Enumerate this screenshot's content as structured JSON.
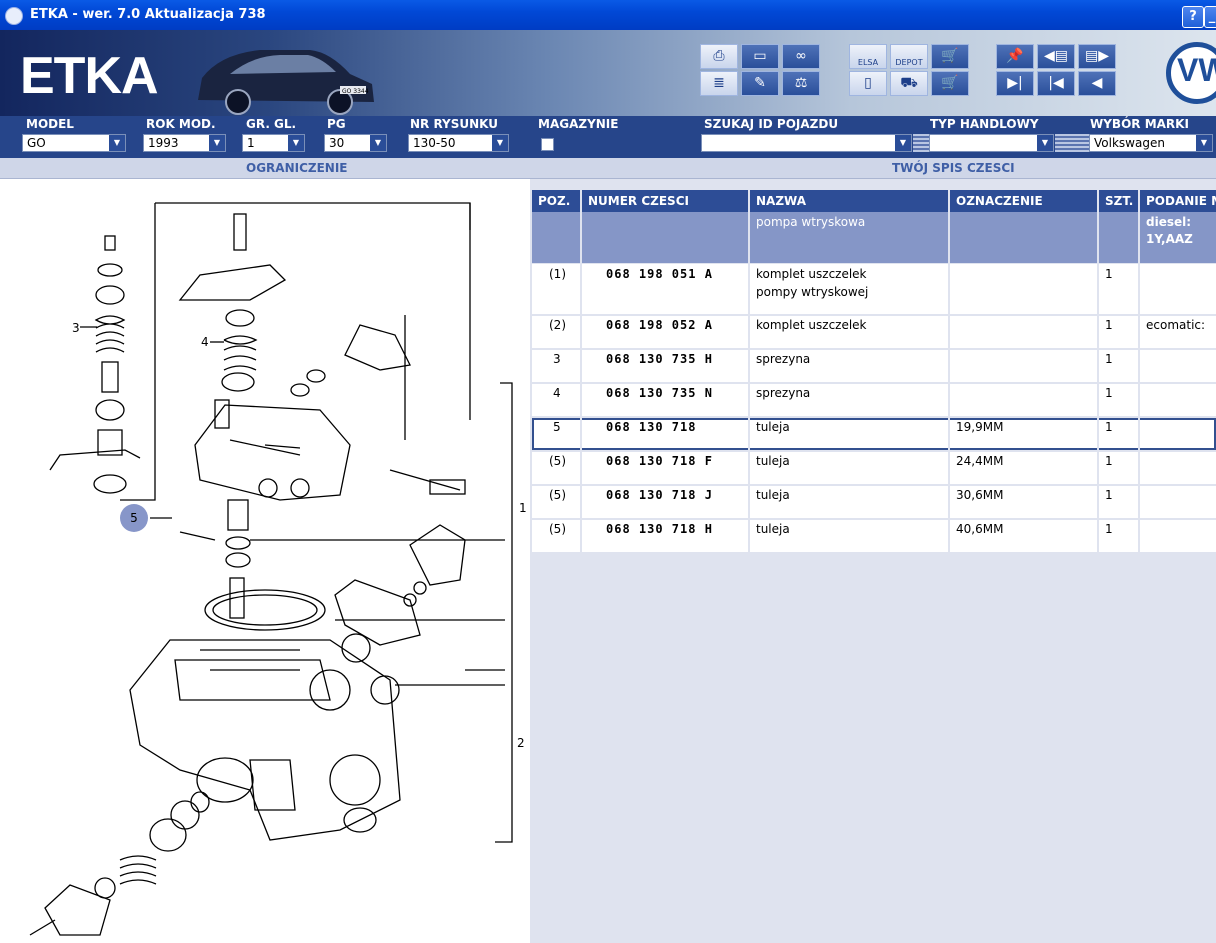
{
  "window": {
    "title": "ETKA - wer. 7.0 Aktualizacja 738",
    "help_label": "?",
    "min_label": "_"
  },
  "banner": {
    "logo": "ETKA",
    "plate": "GO 3344",
    "toolbar_icons": [
      "print-icon",
      "screen-icon",
      "glasses-icon",
      "list-icon",
      "pencil-icon",
      "scale-icon",
      "elsa-icon",
      "depot-icon",
      "cart-icon",
      "monitor-icon",
      "truck-icon",
      "cart-add-icon",
      "pin-icon",
      "doc-back-icon",
      "doc-forward-icon",
      "last-icon",
      "first-icon",
      "prev-icon"
    ],
    "elsa_label": "ELSA",
    "depot_label": "DEPOT",
    "brand_logo": "VW"
  },
  "filters": {
    "model": {
      "label": "MODEL",
      "value": "GO"
    },
    "rok_mod": {
      "label": "ROK MOD.",
      "value": "1993"
    },
    "gr_gl": {
      "label": "GR. GL.",
      "value": "1"
    },
    "pg": {
      "label": "PG",
      "value": "30"
    },
    "nr_rysunku": {
      "label": "NR RYSUNKU",
      "value": "130-50"
    },
    "magazynie": {
      "label": "MAGAZYNIE",
      "checked": false
    },
    "szukaj": {
      "label": "SZUKAJ ID POJAZDU",
      "value": ""
    },
    "typ": {
      "label": "TYP HANDLOWY",
      "value": ""
    },
    "marka": {
      "label": "WYBÓR MARKI",
      "value": "Volkswagen"
    }
  },
  "sections": {
    "left": "OGRANICZENIE",
    "right": "TWÓJ SPIS CZESCI"
  },
  "diagram": {
    "callouts": [
      "3",
      "4",
      "5",
      "1",
      "2"
    ]
  },
  "table": {
    "headers": {
      "poz": "POZ.",
      "numer": "NUMER CZESCI",
      "nazwa": "NAZWA",
      "oznaczenie": "OZNACZENIE",
      "szt": "SZT.",
      "podanie": "PODANIE M"
    },
    "group": {
      "nazwa": "pompa wtryskowa",
      "podanie_1": "diesel:",
      "podanie_2": "1Y,AAZ"
    },
    "rows": [
      {
        "poz": "(1)",
        "numer": "068 198 051 A",
        "nazwa": "komplet uszczelek",
        "nazwa2": "pompy wtryskowej",
        "oznaczenie": "",
        "szt": "1",
        "podanie": ""
      },
      {
        "poz": "(2)",
        "numer": "068 198 052 A",
        "nazwa": "komplet uszczelek",
        "nazwa2": "",
        "oznaczenie": "",
        "szt": "1",
        "podanie": "ecomatic:"
      },
      {
        "poz": "3",
        "numer": "068 130 735 H",
        "nazwa": "sprezyna",
        "nazwa2": "",
        "oznaczenie": "",
        "szt": "1",
        "podanie": ""
      },
      {
        "poz": "4",
        "numer": "068 130 735 N",
        "nazwa": "sprezyna",
        "nazwa2": "",
        "oznaczenie": "",
        "szt": "1",
        "podanie": ""
      },
      {
        "poz": "5",
        "numer": "068 130 718",
        "nazwa": "tuleja",
        "nazwa2": "",
        "oznaczenie": "19,9MM",
        "szt": "1",
        "podanie": ""
      },
      {
        "poz": "(5)",
        "numer": "068 130 718 F",
        "nazwa": "tuleja",
        "nazwa2": "",
        "oznaczenie": "24,4MM",
        "szt": "1",
        "podanie": ""
      },
      {
        "poz": "(5)",
        "numer": "068 130 718 J",
        "nazwa": "tuleja",
        "nazwa2": "",
        "oznaczenie": "30,6MM",
        "szt": "1",
        "podanie": ""
      },
      {
        "poz": "(5)",
        "numer": "068 130 718 H",
        "nazwa": "tuleja",
        "nazwa2": "",
        "oznaczenie": "40,6MM",
        "szt": "1",
        "podanie": ""
      }
    ]
  }
}
